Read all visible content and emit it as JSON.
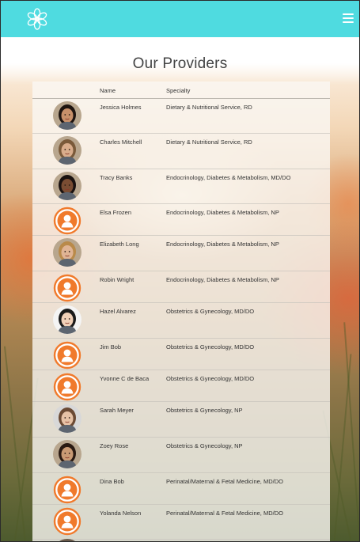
{
  "page": {
    "title": "Our Providers"
  },
  "header": {
    "logo_icon": "flower-logo-icon",
    "menu_icon": "hamburger-menu-icon",
    "accent": "#4fdbe0"
  },
  "table": {
    "columns": {
      "name": "Name",
      "specialty": "Specialty"
    },
    "rows": [
      {
        "name": "Jessica Holmes",
        "specialty": "Dietary & Nutritional Service, RD",
        "photo": "photo",
        "skin": "#c8906a",
        "hair": "#1e1410"
      },
      {
        "name": "Charles Mitchell",
        "specialty": "Dietary & Nutritional Service, RD",
        "photo": "photo",
        "skin": "#d9ad8c",
        "hair": "#7a5a3a"
      },
      {
        "name": "Tracy Banks",
        "specialty": "Endocrinology, Diabetes & Metabolism, MD/DO",
        "photo": "photo",
        "skin": "#7a4d33",
        "hair": "#1a1210"
      },
      {
        "name": "Elsa Frozen",
        "specialty": "Endocrinology, Diabetes & Metabolism, NP",
        "photo": "placeholder"
      },
      {
        "name": "Elizabeth Long",
        "specialty": "Endocrinology, Diabetes & Metabolism, NP",
        "photo": "photo",
        "skin": "#e0b494",
        "hair": "#b98a4a"
      },
      {
        "name": "Robin Wright",
        "specialty": "Endocrinology, Diabetes & Metabolism, NP",
        "photo": "placeholder"
      },
      {
        "name": "Hazel Alvarez",
        "specialty": "Obstetrics & Gynecology, MD/DO",
        "photo": "photo",
        "skin": "#f0d0b8",
        "hair": "#1a1a1a",
        "bg": "#f4f4f4"
      },
      {
        "name": "Jim Bob",
        "specialty": "Obstetrics & Gynecology, MD/DO",
        "photo": "placeholder"
      },
      {
        "name": "Yvonne C de Baca",
        "specialty": "Obstetrics & Gynecology, MD/DO",
        "photo": "placeholder"
      },
      {
        "name": "Sarah Meyer",
        "specialty": "Obstetrics & Gynecology, NP",
        "photo": "photo",
        "skin": "#e6c2a6",
        "hair": "#6b4a34",
        "bg": "#d8d8d8"
      },
      {
        "name": "Zoey Rose",
        "specialty": "Obstetrics & Gynecology, NP",
        "photo": "photo",
        "skin": "#c99a74",
        "hair": "#2a1a12"
      },
      {
        "name": "Dina Bob",
        "specialty": "Perinatal/Maternal & Fetal Medicine, MD/DO",
        "photo": "placeholder"
      },
      {
        "name": "Yolanda Nelson",
        "specialty": "Perinatal/Maternal & Fetal Medicine, MD/DO",
        "photo": "placeholder"
      }
    ]
  },
  "colors": {
    "placeholder_avatar": "#f07a2c"
  }
}
